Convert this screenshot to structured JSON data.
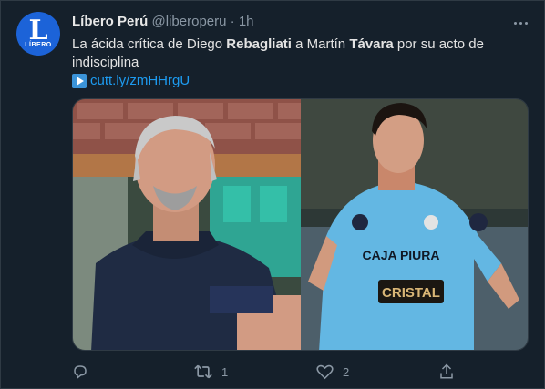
{
  "tweet": {
    "author_name": "Líbero Perú",
    "handle": "@liberoperu",
    "separator": "·",
    "time": "1h",
    "text": {
      "part1": "La ácida crítica de Diego ",
      "bold1": "Rebagliati",
      "part2": " a Martín ",
      "bold2": "Távara",
      "part3": " por su acto de indisciplina"
    },
    "link": "cutt.ly/zmHHrgU",
    "avatar": {
      "letter": "L",
      "brand": "LÍBERO",
      "color": "#1c63d8"
    },
    "media": {
      "left_photo": "man-in-dark-hoodie",
      "right_photo": "footballer-sky-blue-jersey",
      "jersey_text_1": "CAJA PIURA",
      "jersey_text_2": "CRISTAL"
    },
    "actions": {
      "reply_icon": "reply-icon",
      "retweet_icon": "retweet-icon",
      "retweet_count": "1",
      "like_icon": "heart-icon",
      "like_count": "2",
      "share_icon": "share-icon"
    }
  },
  "colors": {
    "background": "#15202b",
    "link": "#1d9bf0",
    "muted": "#8b98a5"
  }
}
